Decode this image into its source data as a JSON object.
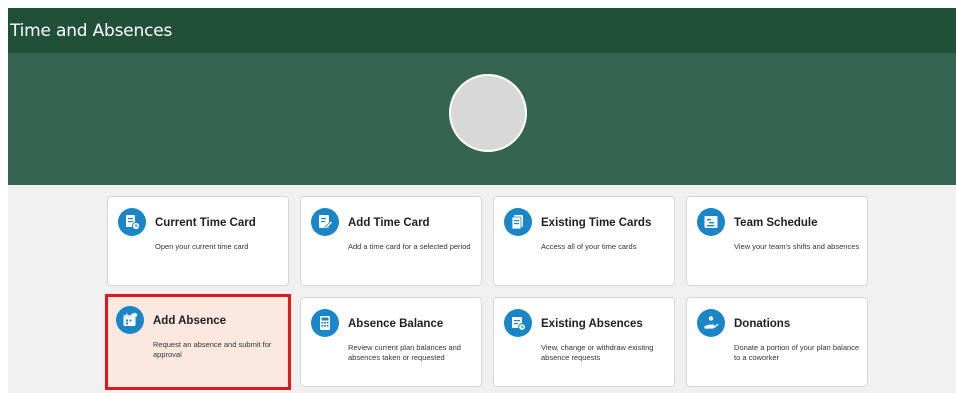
{
  "header": {
    "title": "Time and Absences"
  },
  "banner": {
    "avatar_label": ""
  },
  "colors": {
    "header_bg": "#215039",
    "banner_bg": "#356552",
    "icon_bg": "#1a85c7",
    "selected_border": "#e0191c",
    "selected_bg": "#fbe9e0"
  },
  "cards": [
    {
      "title": "Current Time Card",
      "desc": "Open your current time card",
      "icon": "time-card-clock-icon"
    },
    {
      "title": "Add Time Card",
      "desc": "Add a time card for a selected period",
      "icon": "edit-document-icon"
    },
    {
      "title": "Existing Time Cards",
      "desc": "Access all of your time cards",
      "icon": "documents-icon"
    },
    {
      "title": "Team Schedule",
      "desc": "View your team's shifts and absences",
      "icon": "schedule-chart-icon"
    },
    {
      "title": "Add Absence",
      "desc": "Request an absence and submit for approval",
      "icon": "calendar-add-icon",
      "selected": true
    },
    {
      "title": "Absence Balance",
      "desc": "Review current plan balances and absences taken or requested",
      "icon": "calculator-icon"
    },
    {
      "title": "Existing Absences",
      "desc": "View, change or withdraw existing absence requests",
      "icon": "document-clock-icon"
    },
    {
      "title": "Donations",
      "desc": "Donate a portion of your plan balance to a coworker",
      "icon": "donate-hand-icon"
    }
  ]
}
